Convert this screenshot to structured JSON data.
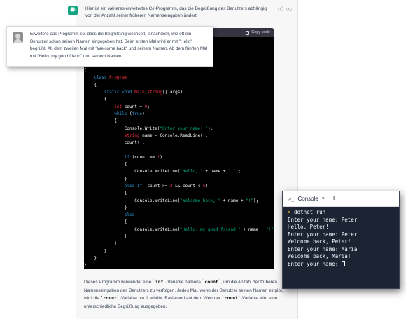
{
  "chat": {
    "intro": "Hier ist ein weiteres erweitertes C#-Programm, das die Begrüßung des Benutzers abhängig von der Anzahl seiner früheren Namenseingaben ändert:",
    "copy_label": "Copy code",
    "code_lines": [
      "",
      "",
      "",
      "",
      "{",
      "    class Program",
      "    {",
      "        static void Main(string[] args)",
      "        {",
      "            int count = 0;",
      "            while (true)",
      "            {",
      "                Console.Write(\"Enter your name: \");",
      "                string name = Console.ReadLine();",
      "                count++;",
      "",
      "                if (count == 1)",
      "                {",
      "                    Console.WriteLine(\"Hello, \" + name + \"!\");",
      "                }",
      "                else if (count >= 2 && count < 5)",
      "                {",
      "                    Console.WriteLine(\"Welcome back, \" + name + \"!\");",
      "                }",
      "                else",
      "                {",
      "                    Console.WriteLine(\"Hello, my good friend \" + name + \"!\");",
      "                }",
      "            }",
      "        }",
      "    }",
      "}"
    ],
    "outro": [
      {
        "t": "Dieses Programm verwendet eine "
      },
      {
        "t": "`int`",
        "code": true
      },
      {
        "t": "-Variable namens "
      },
      {
        "t": "`count`",
        "code": true
      },
      {
        "t": ", um die Anzahl der früheren Namenseingaben des Benutzers zu verfolgen. Jedes Mal, wenn der Benutzer seinen Namen eingibt, wird die "
      },
      {
        "t": "`count`",
        "code": true
      },
      {
        "t": "-Variable um 1 erhöht. Basierend auf dem Wert der "
      },
      {
        "t": "`count`",
        "code": true
      },
      {
        "t": "-Variable wird eine unterschiedliche Begrüßung ausgegeben."
      }
    ]
  },
  "prompt": {
    "text": "Erweitere das Programm so, dass die Begrüßung wechselt, jenachdem, wie oft ein Benutzer schon seinen Namen eingegeben hat. Beim ersten Mal wird er mit \"Hello\" begrüßt. Ab dem zweiten Mal mit \"Welcome back\" und seinem Namen. Ab dem fünften Mal mit \"Hello, my good friend\" und seinem Namen."
  },
  "console": {
    "tab_label": "Console",
    "prompt_glyph": ">_",
    "close_glyph": "×",
    "add_glyph": "+",
    "command": "dotnet run",
    "output": [
      "Enter your name: Peter",
      "Hello, Peter!",
      "Enter your name: Peter",
      "Welcome back, Peter!",
      "Enter your name: Maria",
      "Welcome back, Maria!",
      "Enter your name: "
    ]
  },
  "icons": {
    "assistant": "openai-logo-icon",
    "thumbs_up": "thumbs-up-icon",
    "thumbs_down": "thumbs-down-icon",
    "copy": "clipboard-icon",
    "user": "user-avatar-icon"
  },
  "colors": {
    "assistant_green": "#10a37f",
    "code_bg": "#000000",
    "keyword": "#2e95d3",
    "type": "#f22c3d",
    "string": "#00a67d",
    "number": "#df3079",
    "console_bg": "#1c2333",
    "console_prompt": "#f0b429"
  }
}
